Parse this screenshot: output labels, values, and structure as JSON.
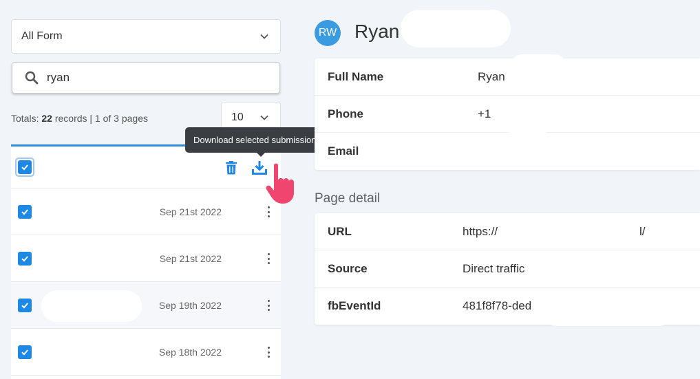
{
  "filters": {
    "form_select_value": "All Form",
    "search_value": "ryan",
    "totals_prefix": "Totals:",
    "totals_count": "22",
    "totals_suffix": "records | 1 of 3 pages",
    "per_page_value": "10"
  },
  "list": {
    "tooltip": "Download selected submissions",
    "rows": [
      {
        "date": "Sep 21st 2022",
        "checked": true
      },
      {
        "date": "Sep 21st 2022",
        "checked": true
      },
      {
        "date": "Sep 19th 2022",
        "checked": true
      },
      {
        "date": "Sep 18th 2022",
        "checked": true
      }
    ]
  },
  "detail": {
    "avatar_initials": "RW",
    "name": "Ryan",
    "contact": [
      {
        "label": "Full Name",
        "value": "Ryan"
      },
      {
        "label": "Phone",
        "value": "+1"
      },
      {
        "label": "Email",
        "value": ""
      }
    ],
    "page_detail_title": "Page detail",
    "page_detail": {
      "url_label": "URL",
      "url_value_start": "https://",
      "url_value_end": "l/",
      "source_label": "Source",
      "source_value": "Direct traffic",
      "fbeventid_label": "fbEventId",
      "fbeventid_value": "481f8f78-ded"
    }
  },
  "colors": {
    "accent": "#1e88e5",
    "link": "#2d8ce0",
    "pointer_hand": "#f0456e",
    "tooltip_bg": "#3a3d42"
  },
  "icons": [
    "chevron-down-icon",
    "search-icon",
    "trash-icon",
    "download-icon",
    "kebab-icon",
    "checkmark-icon",
    "pointer-hand-icon"
  ]
}
